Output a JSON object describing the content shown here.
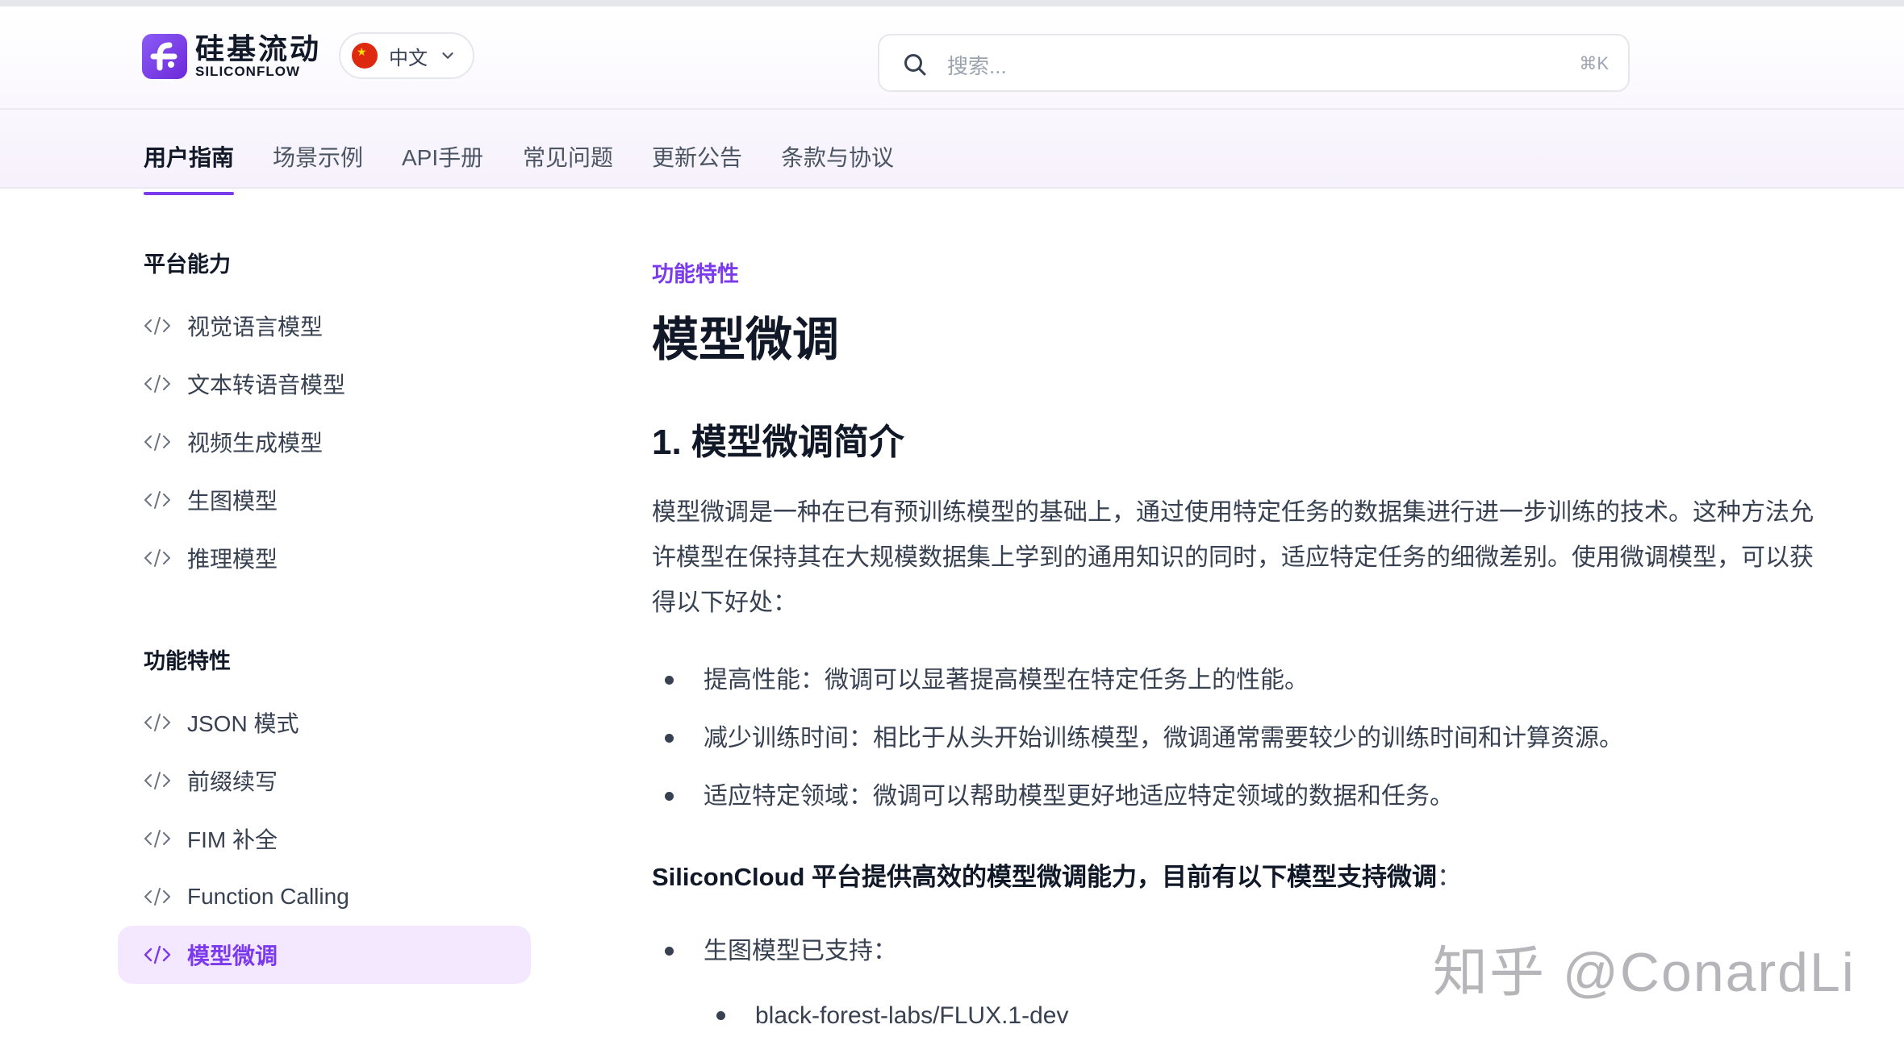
{
  "header": {
    "logo_cn": "硅基流动",
    "logo_en": "SILICONFLOW",
    "language": "中文",
    "search_placeholder": "搜索...",
    "search_shortcut": "⌘K"
  },
  "nav": {
    "tabs": [
      {
        "label": "用户指南",
        "active": true
      },
      {
        "label": "场景示例",
        "active": false
      },
      {
        "label": "API手册",
        "active": false
      },
      {
        "label": "常见问题",
        "active": false
      },
      {
        "label": "更新公告",
        "active": false
      },
      {
        "label": "条款与协议",
        "active": false
      }
    ]
  },
  "sidebar": {
    "sections": [
      {
        "heading": "平台能力",
        "items": [
          {
            "label": "视觉语言模型"
          },
          {
            "label": "文本转语音模型"
          },
          {
            "label": "视频生成模型"
          },
          {
            "label": "生图模型"
          },
          {
            "label": "推理模型"
          }
        ]
      },
      {
        "heading": "功能特性",
        "items": [
          {
            "label": "JSON 模式"
          },
          {
            "label": "前缀续写"
          },
          {
            "label": "FIM 补全"
          },
          {
            "label": "Function Calling"
          },
          {
            "label": "模型微调",
            "active": true
          }
        ]
      }
    ]
  },
  "main": {
    "eyebrow": "功能特性",
    "title": "模型微调",
    "section_heading": "1. 模型微调简介",
    "intro": "模型微调是一种在已有预训练模型的基础上，通过使用特定任务的数据集进行进一步训练的技术。这种方法允许模型在保持其在大规模数据集上学到的通用知识的同时，适应特定任务的细微差别。使用微调模型，可以获得以下好处：",
    "benefits": [
      "提高性能：微调可以显著提高模型在特定任务上的性能。",
      "减少训练时间：相比于从头开始训练模型，微调通常需要较少的训练时间和计算资源。",
      "适应特定领域：微调可以帮助模型更好地适应特定领域的数据和任务。"
    ],
    "support_statement": "SiliconCloud 平台提供高效的模型微调能力，目前有以下模型支持微调",
    "support_colon": "：",
    "supported": {
      "label": "生图模型已支持：",
      "models": [
        "black-forest-labs/FLUX.1-dev"
      ]
    }
  },
  "watermark": "知乎 @ConardLi",
  "colors": {
    "accent": "#7c3aed",
    "active_bg": "#f3e8ff"
  }
}
